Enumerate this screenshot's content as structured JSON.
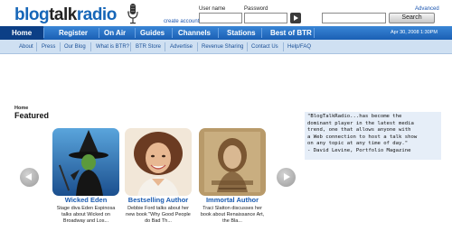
{
  "header": {
    "logo": {
      "part1": "blog",
      "part2": "talk",
      "part3": "radio",
      "tm": "com"
    },
    "create_account": "create account",
    "username_label": "User name",
    "password_label": "Password",
    "username_value": "",
    "password_value": "",
    "search_value": "",
    "advanced_link": "Advanced",
    "search_button": "Search"
  },
  "main_nav": {
    "items": [
      "Home",
      "Register",
      "On Air",
      "Guides",
      "Channels",
      "Stations",
      "Best of BTR"
    ],
    "active_index": 0,
    "date": "Apr 30, 2008 1:30PM"
  },
  "sub_nav": {
    "items": [
      "About",
      "Press",
      "Our Blog",
      "What is BTR?",
      "BTR Store",
      "Advertise",
      "Revenue Sharing",
      "Contact Us",
      "Help/FAQ"
    ]
  },
  "breadcrumb": "Home",
  "section_title": "Featured",
  "quote": {
    "lines": [
      "\"BlogTalkRadio...has become the",
      "dominant player in the latest media",
      "trend, one that allows anyone with",
      "a Web connection to host a talk show",
      "on any topic at any time of day.\"",
      "- David Levine, Portfolio Magazine"
    ]
  },
  "featured": [
    {
      "title": "Wicked Eden",
      "desc": [
        "Stage diva Eden Espinosa",
        "talks about Wicked on",
        "Broadway and Los..."
      ]
    },
    {
      "title": "Bestselling Author",
      "desc": [
        "Debbie Ford talks about her",
        "new book \"Why Good People",
        "do Bad Th..."
      ]
    },
    {
      "title": "Immortal Author",
      "desc": [
        "Traci Slatton discusses her",
        "book about Renaissance Art,",
        "the Bla..."
      ]
    }
  ],
  "colors": {
    "nav_blue": "#1a5fb4",
    "nav_active": "#0c3f86",
    "subnav_bg": "#cfe0f2",
    "link_blue": "#1a5bb0",
    "quote_bg": "#e6eef8"
  }
}
